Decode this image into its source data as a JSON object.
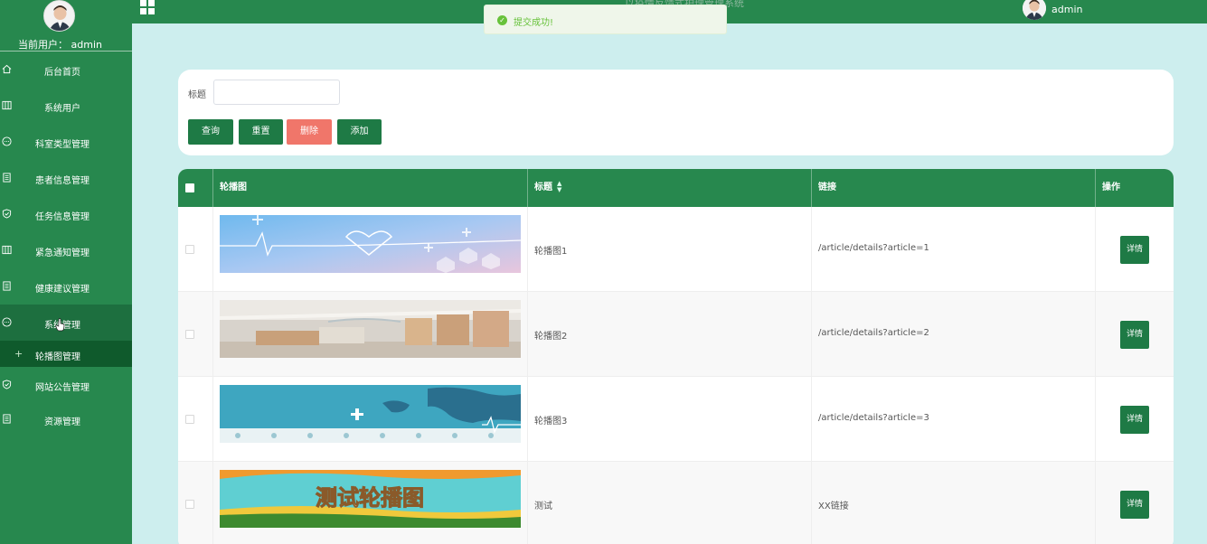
{
  "sidebar": {
    "current_user": "当前用户： admin",
    "items": [
      {
        "label": "后台首页",
        "icon": "home-icon"
      },
      {
        "label": "系统用户",
        "icon": "columns-icon"
      },
      {
        "label": "科室类型管理",
        "icon": "chat-icon"
      },
      {
        "label": "患者信息管理",
        "icon": "document-icon"
      },
      {
        "label": "任务信息管理",
        "icon": "shield-icon"
      },
      {
        "label": "紧急通知管理",
        "icon": "columns-icon"
      },
      {
        "label": "健康建议管理",
        "icon": "document-icon"
      },
      {
        "label": "系统管理",
        "icon": "chat-icon"
      },
      {
        "label": "网站公告管理",
        "icon": "shield-icon"
      },
      {
        "label": "资源管理",
        "icon": "document-icon"
      }
    ],
    "submenu": {
      "label": "轮播图管理"
    }
  },
  "topbar": {
    "title": "以疫情反馈式护理管理系统",
    "user": "admin"
  },
  "toast": {
    "message": "提交成功!"
  },
  "search": {
    "label": "标题",
    "value": "",
    "buttons": {
      "query": "查询",
      "reset": "重置",
      "delete": "删除",
      "add": "添加"
    }
  },
  "table": {
    "headers": {
      "image": "轮播图",
      "title": "标题",
      "link": "链接",
      "action": "操作"
    },
    "rows": [
      {
        "title": "轮播图1",
        "link": "/article/details?article=1",
        "action": "详情"
      },
      {
        "title": "轮播图2",
        "link": "/article/details?article=2",
        "action": "详情"
      },
      {
        "title": "轮播图3",
        "link": "/article/details?article=3",
        "action": "详情"
      },
      {
        "title": "测试",
        "link": "XX链接",
        "action": "详情",
        "banner_text": "测试轮播图"
      }
    ]
  },
  "colors": {
    "primary": "#27884e",
    "button": "#1e7a45",
    "danger": "#f0766a",
    "background": "#cdeeee",
    "success": "#67c23a"
  }
}
